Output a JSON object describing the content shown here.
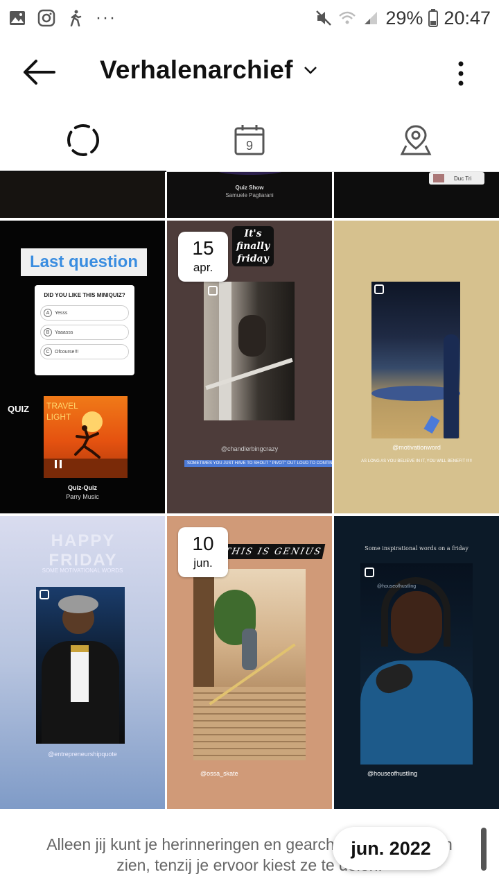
{
  "status_bar": {
    "battery": "29%",
    "time": "20:47",
    "more": "···"
  },
  "header": {
    "title": "Verhalenarchief"
  },
  "tabs": [
    {
      "name": "stories-archive",
      "icon": "dashed-circle-icon",
      "active": true
    },
    {
      "name": "calendar",
      "icon": "calendar-icon",
      "calendar_number": "9"
    },
    {
      "name": "map",
      "icon": "map-pin-icon"
    }
  ],
  "grid": {
    "top_row": {
      "middle_title": "Quiz Show",
      "middle_subtitle": "Samuele Pagliarani",
      "right_label": "Duc Tri"
    },
    "tile_quiz": {
      "heading": "Last question",
      "question": "DID YOU LIKE THIS MINIQUIZ?",
      "options": [
        "Yesss",
        "Yaaasss",
        "Ofcourse!!!"
      ],
      "option_letters": [
        "A",
        "B",
        "C"
      ],
      "quiz_label": "QUIZ",
      "album_text": "TRAVEL LIGHT",
      "song": "Quiz-Quiz",
      "artist": "Parry Music"
    },
    "tile_friday": {
      "date_day": "15",
      "date_month": "apr.",
      "sticker": "It's finally friday",
      "handle": "@chandlerbingcrazy",
      "caption": "SOMETIMES YOU JUST HAVE TO SHOUT \" PIVOT\" OUT LOUD TO CONTINUE"
    },
    "tile_basketball": {
      "handle": "@motivationword",
      "caption": "AS LONG AS YOU BELIEVE IN IT, YOU WILL BENEFIT !!!!!"
    },
    "tile_motivational": {
      "heading": "HAPPY FRIDAY",
      "subheading": "SOME MOTIVATIONAL WORDS",
      "handle": "@entrepreneurshipquote"
    },
    "tile_genius": {
      "date_day": "10",
      "date_month": "jun.",
      "banner": "THIS IS GENIUS",
      "handle": "@ossa_skate"
    },
    "tile_hustling": {
      "top_text": "Some inspirational words on a friday",
      "small_handle": "@houseofhustling",
      "handle": "@houseofhustling"
    }
  },
  "footer": {
    "text": "Alleen jij kunt je herinneringen en gearchiveerde verhalen zien, tenzij je ervoor kiest ze te delen.",
    "current_month": "jun. 2022"
  }
}
